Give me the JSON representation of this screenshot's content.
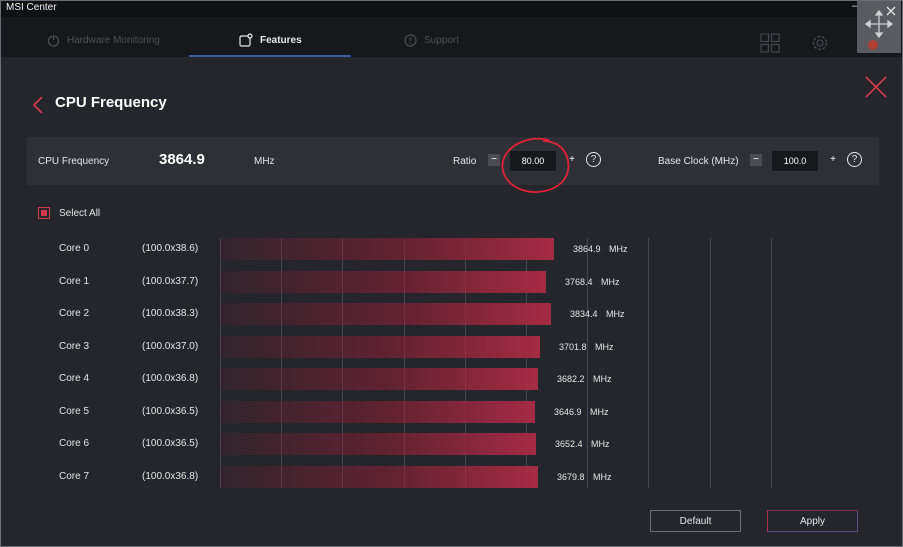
{
  "window": {
    "title": "MSI Center",
    "minimize_glyph": "–"
  },
  "nav": {
    "tabs": [
      {
        "label": "Hardware Monitoring",
        "icon": "power-icon",
        "active": false
      },
      {
        "label": "Features",
        "icon": "features-icon",
        "active": true
      },
      {
        "label": "Support",
        "icon": "info-icon",
        "active": false
      }
    ]
  },
  "page": {
    "title": "CPU Frequency"
  },
  "frequency": {
    "label": "CPU Frequency",
    "value": "3864.9",
    "unit": "MHz",
    "ratio_label": "Ratio",
    "ratio_value": "80.00",
    "base_clock_label": "Base Clock (MHz)",
    "base_clock_value": "100.0",
    "minus": "−",
    "plus": "+",
    "help": "?"
  },
  "select_all": {
    "label": "Select All",
    "checked": true
  },
  "cores": [
    {
      "name": "Core 0",
      "ratio": "(100.0x38.6)",
      "freq": "3864.9",
      "unit": "MHz",
      "mhz": 3864.9
    },
    {
      "name": "Core 1",
      "ratio": "(100.0x37.7)",
      "freq": "3768.4",
      "unit": "MHz",
      "mhz": 3768.4
    },
    {
      "name": "Core 2",
      "ratio": "(100.0x38.3)",
      "freq": "3834.4",
      "unit": "MHz",
      "mhz": 3834.4
    },
    {
      "name": "Core 3",
      "ratio": "(100.0x37.0)",
      "freq": "3701.8",
      "unit": "MHz",
      "mhz": 3701.8
    },
    {
      "name": "Core 4",
      "ratio": "(100.0x36.8)",
      "freq": "3682.2",
      "unit": "MHz",
      "mhz": 3682.2
    },
    {
      "name": "Core 5",
      "ratio": "(100.0x36.5)",
      "freq": "3646.9",
      "unit": "MHz",
      "mhz": 3646.9
    },
    {
      "name": "Core 6",
      "ratio": "(100.0x36.5)",
      "freq": "3652.4",
      "unit": "MHz",
      "mhz": 3652.4
    },
    {
      "name": "Core 7",
      "ratio": "(100.0x36.8)",
      "freq": "3679.8",
      "unit": "MHz",
      "mhz": 3679.8
    }
  ],
  "buttons": {
    "default": "Default",
    "apply": "Apply"
  },
  "colors": {
    "accent": "#d23a4b",
    "bar": "#a52b44",
    "tab_underline": "#3b5aa8",
    "annotation": "#e0223a"
  }
}
